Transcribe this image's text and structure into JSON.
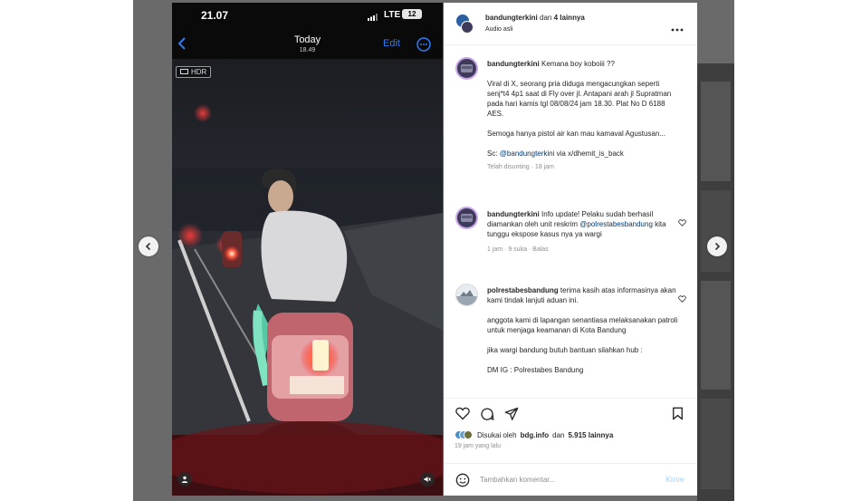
{
  "video": {
    "status_time": "21.07",
    "network": "LTE",
    "battery": "12",
    "nav_title": "Today",
    "nav_subtitle": "18.49",
    "nav_edit": "Edit",
    "hdr_label": "HDR"
  },
  "post": {
    "header_username": "bandungterkini",
    "header_joiner": "dan",
    "header_others": "4 lainnya",
    "audio_label": "Audio asli",
    "caption": {
      "username": "bandungterkini",
      "headline": "Kemana boy koboiii ??",
      "para1": "Viral di X, seorang pria diduga mengacungkan seperti senj*t4 4p1 saat di Fly over jl. Antapani arah jl Supratman pada hari kamis tgl 08/08/24 jam 18.30. Plat No D 6188 AES.",
      "para2": "Semoga hanya pistol air kan mau kamaval Agustusan...",
      "source_prefix": "Sc:",
      "source_mention": "@bandungterkini",
      "source_suffix": "via x/dhemit_is_back",
      "meta": "Telah disunting · 18 jam"
    },
    "comment1": {
      "username": "bandungterkini",
      "text_before": "Info update! Pelaku sudah berhasil diamankan oleh unit reskrim",
      "mention": "@polrestabesbandung",
      "text_after": "kita tunggu ekspose kasus nya ya wargi",
      "meta": "1 jam · 9 suka · Balas"
    },
    "comment2": {
      "username": "polrestabesbandung",
      "text1": "terima kasih atas informasinya akan kami tindak lanjuti aduan ini.",
      "text2": "anggota kami di lapangan senantiasa melaksanakan patroli untuk menjaga keamanan di Kota Bandung",
      "text3": "jika wargi bandung butuh bantuan silahkan hub :",
      "text4": "DM IG : Polrestabes Bandung"
    },
    "likes_prefix": "Disukai oleh",
    "likes_user": "bdg.info",
    "likes_joiner": "dan",
    "likes_count": "5.915 lainnya",
    "time_ago": "19 jam yang lalu",
    "comment_placeholder": "Tambahkan komentar...",
    "post_button": "Kirim"
  },
  "icons": [
    "chevron-left-icon",
    "chevron-right-icon",
    "heart-icon",
    "comment-icon",
    "share-icon",
    "bookmark-icon",
    "emoji-icon",
    "more-icon"
  ],
  "colors": {
    "accent": "#0095f6",
    "link": "#00376b",
    "muted": "#8e8e8e",
    "ios_blue": "#2f7bf5"
  }
}
